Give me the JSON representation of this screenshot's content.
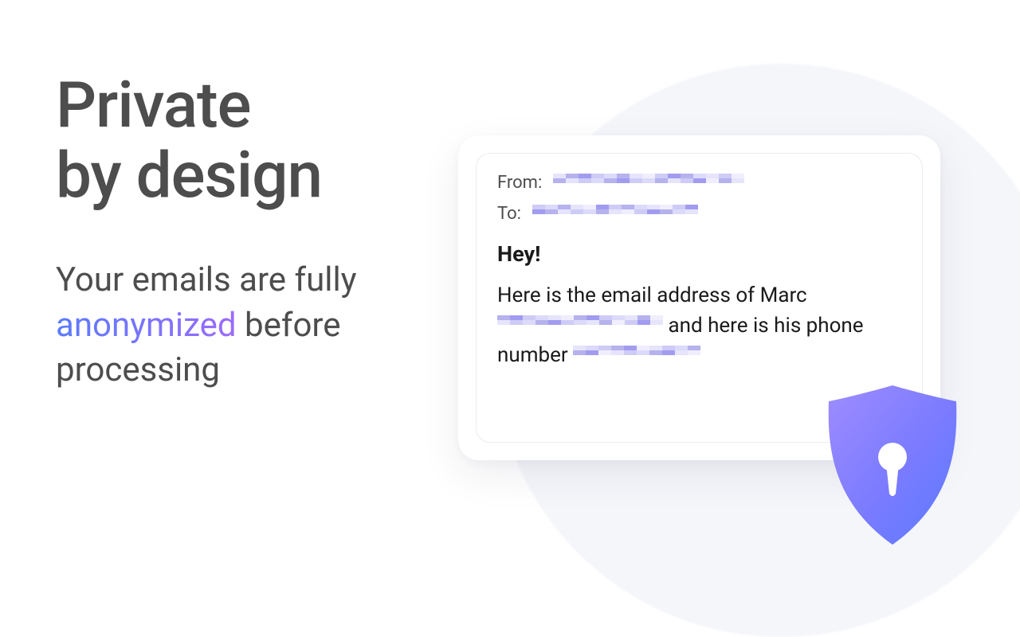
{
  "hero": {
    "headline_line1": "Private",
    "headline_line2": "by design",
    "sub_before": "Your emails are fully ",
    "sub_highlight": "anonymized",
    "sub_after": " before processing"
  },
  "email_card": {
    "from_label": "From:",
    "to_label": "To:",
    "greeting": "Hey!",
    "body_part1": "Here is the email address of Marc ",
    "body_part2": " and here is his phone number "
  },
  "icons": {
    "shield": "lock-shield-icon"
  }
}
